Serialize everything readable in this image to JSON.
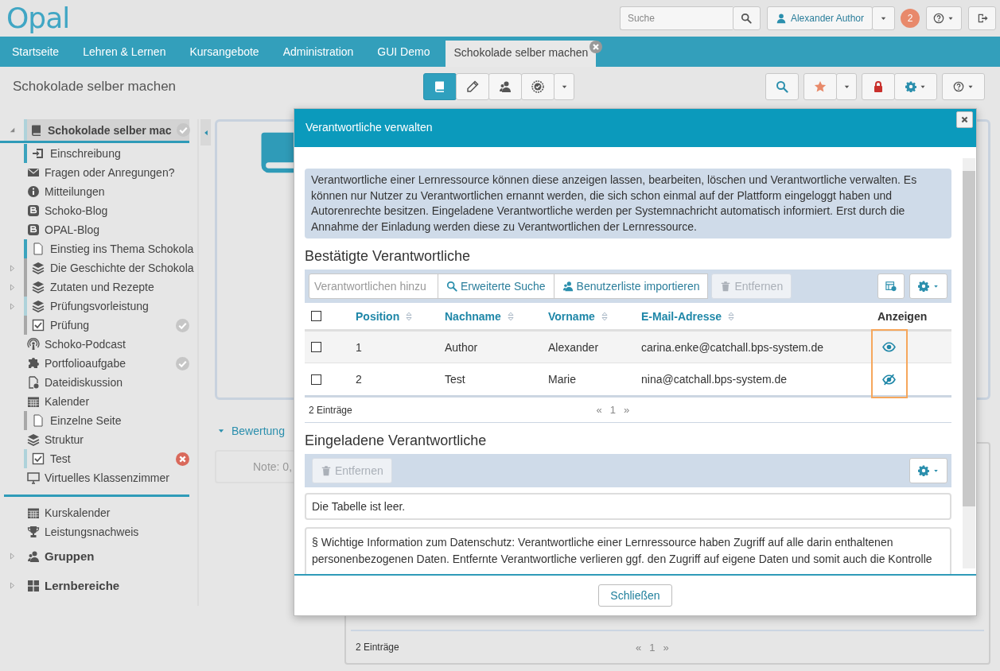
{
  "header": {
    "logo": "Opal",
    "search": {
      "placeholder": "Suche"
    },
    "user": "Alexander Author",
    "notifications": "2"
  },
  "nav": {
    "tabs": [
      {
        "label": "Startseite",
        "selected": false
      },
      {
        "label": "Lehren & Lernen",
        "selected": false
      },
      {
        "label": "Kursangebote",
        "selected": false
      },
      {
        "label": "Administration",
        "selected": false
      },
      {
        "label": "GUI Demo",
        "selected": false
      },
      {
        "label": "Schokolade selber machen",
        "selected": true
      }
    ]
  },
  "course_bar": {
    "title": "Schokolade selber machen",
    "views": [
      {
        "kind": "book",
        "selected": true
      },
      {
        "kind": "pencil",
        "selected": false
      },
      {
        "kind": "users",
        "selected": false
      },
      {
        "kind": "badge",
        "selected": false
      }
    ]
  },
  "sidebar": {
    "root": {
      "label": "Schokolade selber mac",
      "expanded": true,
      "passed": true
    },
    "items": [
      {
        "label": "Einschreibung",
        "kind": "login",
        "color": "#3ba3bd"
      },
      {
        "label": "Fragen oder Anregungen?",
        "kind": "mail"
      },
      {
        "label": "Mitteilungen",
        "kind": "info"
      },
      {
        "label": "Schoko-Blog",
        "kind": "blog"
      },
      {
        "label": "OPAL-Blog",
        "kind": "blog"
      },
      {
        "label": "Einstieg ins Thema Schokola",
        "kind": "page",
        "color": "#3ba3bd"
      },
      {
        "label": "Die Geschichte der Schokola",
        "kind": "layers",
        "color": "#a8a8a8",
        "expanded": false
      },
      {
        "label": "Zutaten und Rezepte",
        "kind": "layers",
        "color": "#a8a8a8",
        "expanded": false
      },
      {
        "label": "Prüfungsvorleistung",
        "kind": "layers",
        "color": "#aed2da",
        "expanded": false
      },
      {
        "label": "Prüfung",
        "kind": "checkbox",
        "color": "#a8a8a8",
        "passed": true
      },
      {
        "label": "Schoko-Podcast",
        "kind": "podcast"
      },
      {
        "label": "Portfolioaufgabe",
        "kind": "puzzle",
        "passed": true
      },
      {
        "label": "Dateidiskussion",
        "kind": "filediscuss"
      },
      {
        "label": "Kalender",
        "kind": "calendar"
      },
      {
        "label": "Einzelne Seite",
        "kind": "page",
        "color": "#a8a8a8"
      },
      {
        "label": "Struktur",
        "kind": "layers"
      },
      {
        "label": "Test",
        "kind": "checkbox",
        "color": "#aed2da",
        "passed": false
      },
      {
        "label": "Virtuelles Klassenzimmer",
        "kind": "monitor"
      }
    ],
    "tools": [
      {
        "label": "Kurskalender",
        "kind": "calendar"
      },
      {
        "label": "Leistungsnachweis",
        "kind": "trophy"
      }
    ],
    "sections": [
      {
        "label": "Gruppen",
        "kind": "users",
        "expanded": false
      },
      {
        "label": "Lernbereiche",
        "kind": "grid",
        "expanded": false
      }
    ]
  },
  "content": {
    "section": {
      "label": "Bewertung",
      "expanded": true
    },
    "note": "Note: 0,",
    "panel": {
      "count": "2 Einträge",
      "pager": [
        "«",
        "1",
        "»"
      ]
    }
  },
  "dialog": {
    "title": "Verantwortliche verwalten",
    "info": "Verantwortliche einer Lernressource können diese anzeigen lassen, bearbeiten, löschen und Verantwortliche verwalten. Es können nur Nutzer zu Verantwortlichen ernannt werden, die sich schon einmal auf der Plattform eingeloggt haben und Autorenrechte besitzen. Eingeladene Verantwortliche werden per Systemnachricht automatisch informiert. Erst durch die Annahme der Einladung werden diese zu Verantwortlichen der Lernressource.",
    "confirmed": {
      "heading": "Bestätigte Verantwortliche",
      "all_checked": false,
      "add_field": {
        "placeholder": "Verantwortlichen hinzu"
      },
      "buttons": [
        {
          "label": "Erweiterte Suche",
          "kind": "search",
          "disabled": false
        },
        {
          "label": "Benutzerliste importieren",
          "kind": "users",
          "disabled": false
        },
        {
          "label": "Entfernen",
          "kind": "trash",
          "disabled": true
        }
      ],
      "columns": [
        {
          "label": "Position",
          "sortable": true
        },
        {
          "label": "Nachname",
          "sortable": true
        },
        {
          "label": "Vorname",
          "sortable": true
        },
        {
          "label": "E-Mail-Adresse",
          "sortable": true
        },
        {
          "label": "Anzeigen",
          "sortable": false,
          "highlighted": true
        }
      ],
      "rows": [
        {
          "checked": false,
          "cells": [
            "1",
            "Author",
            "Alexander",
            "carina.enke@catchall.bps-system.de"
          ],
          "visible": true
        },
        {
          "checked": false,
          "cells": [
            "2",
            "Test",
            "Marie",
            "nina@catchall.bps-system.de"
          ],
          "visible": false
        }
      ],
      "count": "2 Einträge",
      "pager": [
        "«",
        "1",
        "»"
      ]
    },
    "invited": {
      "heading": "Eingeladene Verantwortliche",
      "buttons": [
        {
          "label": "Entfernen",
          "kind": "trash",
          "disabled": true
        }
      ],
      "empty": "Die Tabelle ist leer."
    },
    "privacy": "§ Wichtige Information zum Datenschutz: Verantwortliche einer Lernressource haben Zugriff auf alle darin enthaltenen personenbezogenen Daten. Entfernte Verantwortliche verlieren ggf. den Zugriff auf eigene Daten und somit auch die Kontrolle",
    "close": "Schließen"
  }
}
